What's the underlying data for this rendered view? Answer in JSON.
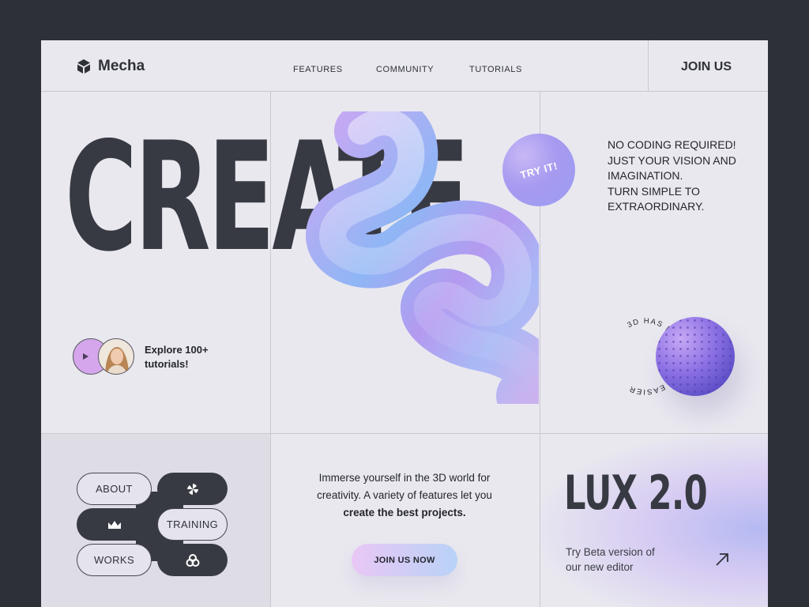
{
  "header": {
    "brand": "Mecha",
    "nav": [
      "FEATURES",
      "COMMUNITY",
      "TUTORIALS"
    ],
    "cta": "JOIN US"
  },
  "hero": {
    "headline": "CREATE",
    "badge": "TRY IT!",
    "tagline": [
      "NO CODING REQUIRED!",
      "JUST YOUR VISION AND",
      "IMAGINATION.",
      "TURN SIMPLE TO",
      "EXTRAORDINARY."
    ],
    "explore": [
      "Explore 100+",
      "tutorials!"
    ],
    "ring_text": "3D HAS NEVER BEEN EASIER"
  },
  "menu": {
    "about": "ABOUT",
    "training": "TRAINING",
    "works": "WORKS"
  },
  "promo": {
    "line1": "Immerse yourself in the 3D world for",
    "line2": "creativity. A variety of features let you",
    "line3": "create the best projects.",
    "button": "JOIN US NOW"
  },
  "lux": {
    "title": "LUX 2.0",
    "sub": [
      "Try Beta version of",
      "our new editor"
    ]
  },
  "colors": {
    "background": "#2e3038",
    "page": "#e9e8ef",
    "dark": "#383a43",
    "accent_purple": "#a79af0"
  }
}
